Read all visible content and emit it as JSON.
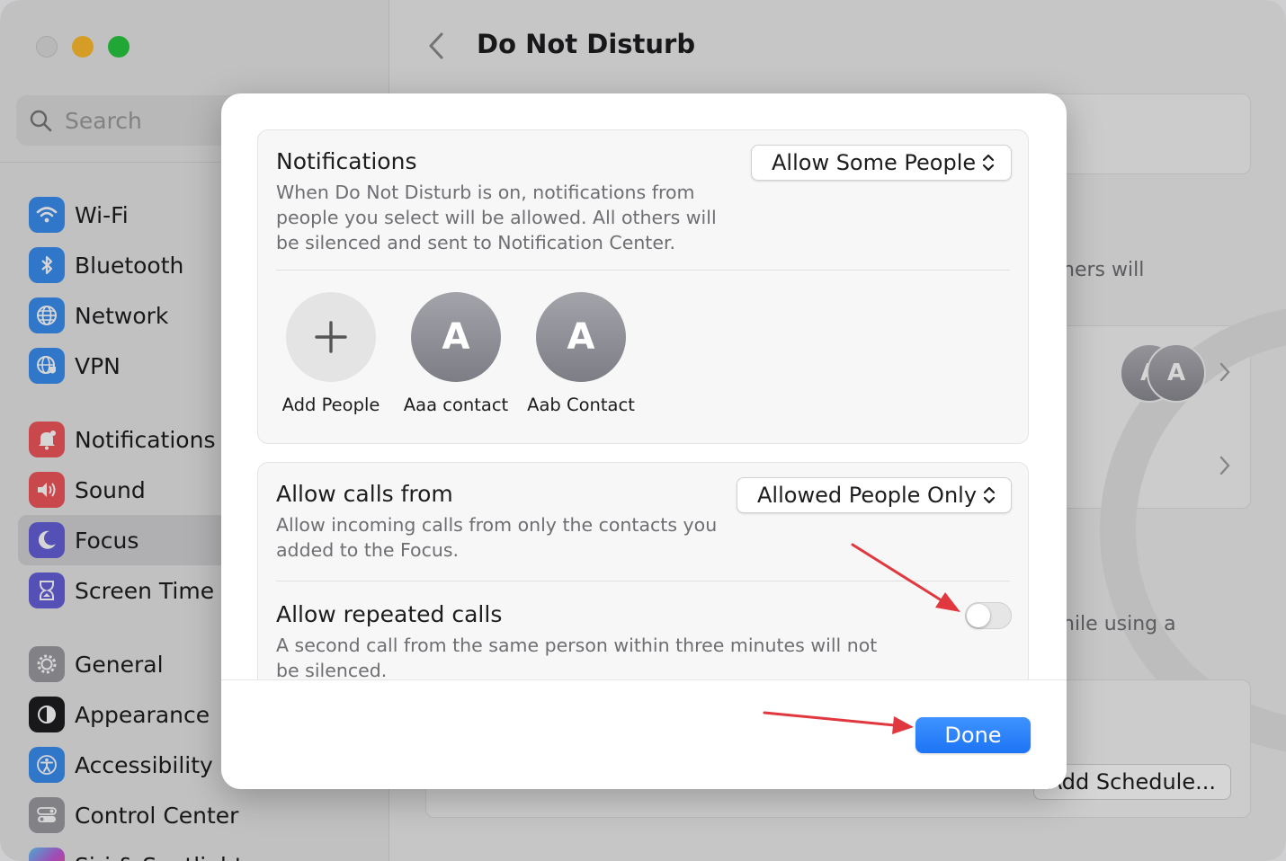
{
  "window": {
    "title": "Do Not Disturb"
  },
  "search": {
    "placeholder": "Search"
  },
  "sidebar": {
    "items": [
      {
        "label": "Wi-Fi",
        "icon": "wifi-icon",
        "color": "#3b8ef0"
      },
      {
        "label": "Bluetooth",
        "icon": "bluetooth-icon",
        "color": "#3b8ef0"
      },
      {
        "label": "Network",
        "icon": "globe-icon",
        "color": "#3b8ef0"
      },
      {
        "label": "VPN",
        "icon": "vpn-icon",
        "color": "#3b8ef0"
      },
      {
        "label": "Notifications",
        "icon": "bell-icon",
        "color": "#f0565b"
      },
      {
        "label": "Sound",
        "icon": "speaker-icon",
        "color": "#f0565b"
      },
      {
        "label": "Focus",
        "icon": "moon-icon",
        "color": "#6560d8",
        "selected": true
      },
      {
        "label": "Screen Time",
        "icon": "hourglass-icon",
        "color": "#6560d8"
      },
      {
        "label": "General",
        "icon": "gear-icon",
        "color": "#9a9aa0"
      },
      {
        "label": "Appearance",
        "icon": "appearance-icon",
        "color": "#1d1d1f"
      },
      {
        "label": "Accessibility",
        "icon": "accessibility-icon",
        "color": "#3b8ef0"
      },
      {
        "label": "Control Center",
        "icon": "control-center-icon",
        "color": "#9a9aa0"
      },
      {
        "label": "Siri & Spotlight",
        "icon": "siri-icon",
        "color": "#c05ad8"
      }
    ]
  },
  "background": {
    "partial_text_1": "hers will",
    "partial_text_2": "hile using a",
    "avatar_letter_1": "A",
    "avatar_letter_2": "A",
    "add_schedule_label": "Add Schedule..."
  },
  "sheet": {
    "notifications": {
      "title": "Notifications",
      "description": "When Do Not Disturb is on, notifications from people you select will be allowed. All others will be silenced and sent to Notification Center.",
      "popup_value": "Allow Some People"
    },
    "people": [
      {
        "label": "Add People",
        "type": "add"
      },
      {
        "label": "Aaa contact",
        "initial": "A",
        "type": "contact"
      },
      {
        "label": "Aab Contact",
        "initial": "A",
        "type": "contact"
      }
    ],
    "calls": {
      "title": "Allow calls from",
      "description": "Allow incoming calls from only the contacts you added to the Focus.",
      "popup_value": "Allowed People Only"
    },
    "repeated_calls": {
      "title": "Allow repeated calls",
      "description": "A second call from the same person within three minutes will not be silenced.",
      "enabled": false
    },
    "done_label": "Done"
  },
  "colors": {
    "accent": "#1d74f5",
    "annotation_arrow": "#e0383e"
  }
}
